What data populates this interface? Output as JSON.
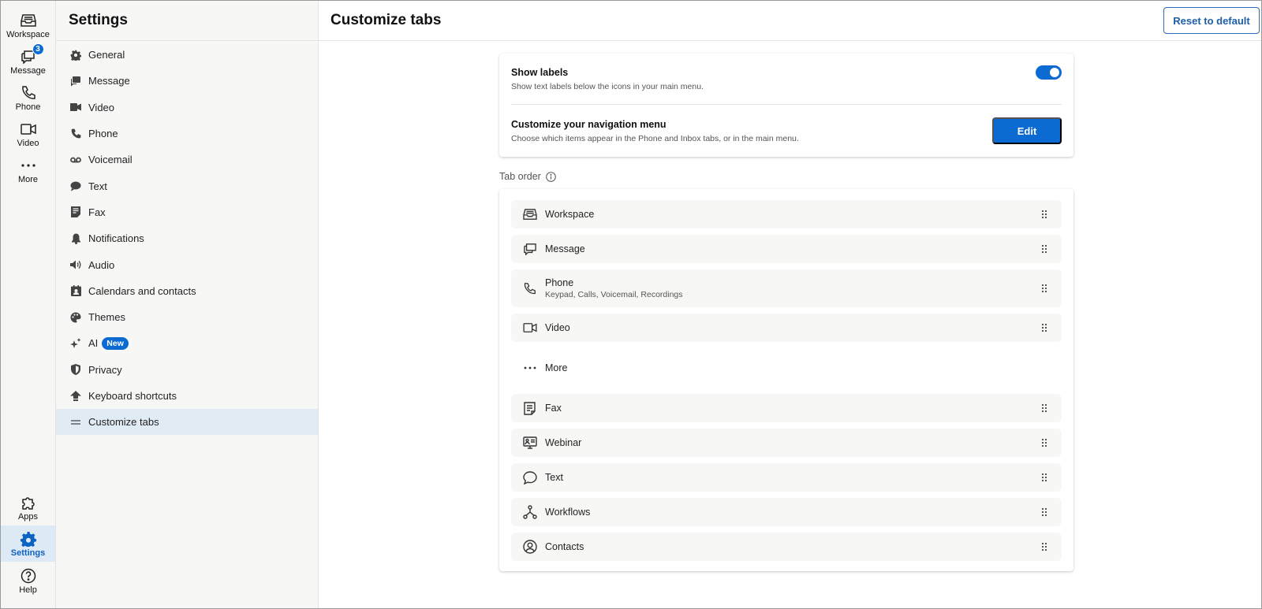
{
  "rail": {
    "items": [
      {
        "label": "Workspace",
        "icon": "inbox-tray-icon"
      },
      {
        "label": "Message",
        "icon": "chat-bubbles-icon",
        "badge": "3"
      },
      {
        "label": "Phone",
        "icon": "phone-icon"
      },
      {
        "label": "Video",
        "icon": "video-camera-icon"
      },
      {
        "label": "More",
        "icon": "more-dots-icon"
      }
    ],
    "bottom": [
      {
        "label": "Apps",
        "icon": "puzzle-icon"
      },
      {
        "label": "Settings",
        "icon": "gear-icon",
        "active": true
      },
      {
        "label": "Help",
        "icon": "help-circle-icon"
      }
    ]
  },
  "sidebar": {
    "title": "Settings",
    "items": [
      {
        "label": "General",
        "icon": "gear-icon"
      },
      {
        "label": "Message",
        "icon": "message-icon"
      },
      {
        "label": "Video",
        "icon": "video-icon"
      },
      {
        "label": "Phone",
        "icon": "phone-icon"
      },
      {
        "label": "Voicemail",
        "icon": "voicemail-icon"
      },
      {
        "label": "Text",
        "icon": "text-bubble-icon"
      },
      {
        "label": "Fax",
        "icon": "fax-icon"
      },
      {
        "label": "Notifications",
        "icon": "bell-icon"
      },
      {
        "label": "Audio",
        "icon": "speaker-icon"
      },
      {
        "label": "Calendars and contacts",
        "icon": "contact-card-icon"
      },
      {
        "label": "Themes",
        "icon": "palette-icon"
      },
      {
        "label": "AI",
        "icon": "sparkle-icon",
        "badge": "New"
      },
      {
        "label": "Privacy",
        "icon": "shield-icon"
      },
      {
        "label": "Keyboard shortcuts",
        "icon": "keyboard-shortcut-icon"
      },
      {
        "label": "Customize tabs",
        "icon": "menu-lines-icon",
        "active": true
      }
    ]
  },
  "main": {
    "title": "Customize tabs",
    "reset_label": "Reset to default",
    "show_labels": {
      "title": "Show labels",
      "description": "Show text labels below the icons in your main menu.",
      "enabled": true
    },
    "customize_nav": {
      "title": "Customize your navigation menu",
      "description": "Choose which items appear in the Phone and Inbox tabs, or in the main menu.",
      "button_label": "Edit"
    },
    "tab_order_label": "Tab order",
    "tabs": [
      {
        "label": "Workspace",
        "icon": "inbox-tray-icon"
      },
      {
        "label": "Message",
        "icon": "chat-bubbles-icon"
      },
      {
        "label": "Phone",
        "sub": "Keypad, Calls, Voicemail, Recordings",
        "icon": "phone-icon"
      },
      {
        "label": "Video",
        "icon": "video-camera-icon"
      },
      {
        "label": "More",
        "icon": "more-dots-icon"
      },
      {
        "label": "Fax",
        "icon": "fax-icon"
      },
      {
        "label": "Webinar",
        "icon": "webinar-icon"
      },
      {
        "label": "Text",
        "icon": "text-bubble-icon"
      },
      {
        "label": "Workflows",
        "icon": "workflow-icon"
      },
      {
        "label": "Contacts",
        "icon": "contact-person-icon"
      }
    ]
  },
  "colors": {
    "accent": "#0b6bd3",
    "active_bg": "#dde9f5",
    "sidebar_bg": "#f7f7f6"
  }
}
